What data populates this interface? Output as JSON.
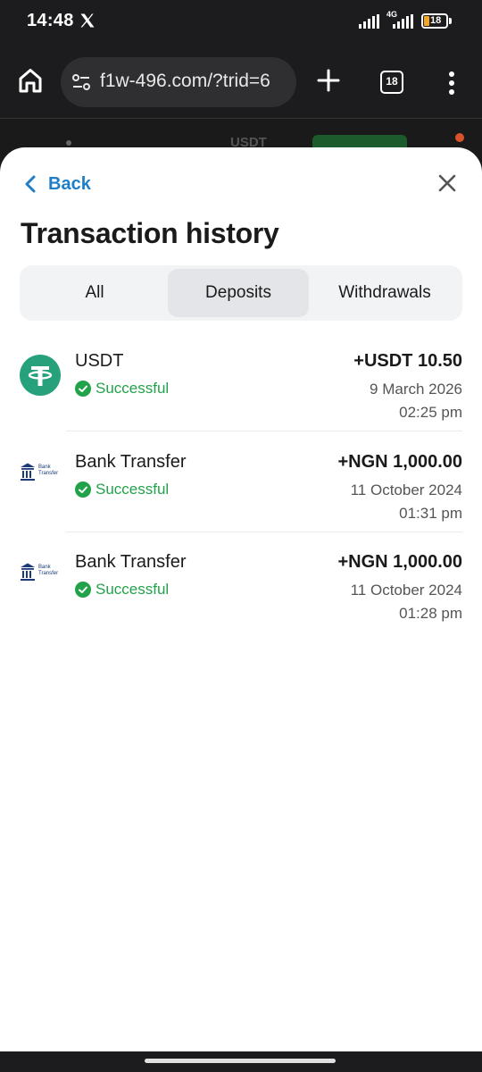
{
  "status_bar": {
    "time": "14:48",
    "network": "4G",
    "battery": "18"
  },
  "browser": {
    "url": "f1w-496.com/?trid=6",
    "tab_count": "18"
  },
  "background_page": {
    "currency": "USDT"
  },
  "sheet": {
    "back_label": "Back",
    "title": "Transaction history",
    "tabs": [
      {
        "label": "All",
        "active": false
      },
      {
        "label": "Deposits",
        "active": true
      },
      {
        "label": "Withdrawals",
        "active": false
      }
    ],
    "transactions": [
      {
        "name": "USDT",
        "status": "Successful",
        "amount": "+USDT 10.50",
        "date": "9 March 2026",
        "time": "02:25 pm",
        "icon": "usdt-icon"
      },
      {
        "name": "Bank Transfer",
        "status": "Successful",
        "amount": "+NGN 1,000.00",
        "date": "11 October 2024",
        "time": "01:31 pm",
        "icon": "bank-transfer-icon",
        "logo_text": [
          "Bank",
          "Transfer"
        ]
      },
      {
        "name": "Bank Transfer",
        "status": "Successful",
        "amount": "+NGN 1,000.00",
        "date": "11 October 2024",
        "time": "01:28 pm",
        "icon": "bank-transfer-icon",
        "logo_text": [
          "Bank",
          "Transfer"
        ]
      }
    ]
  },
  "colors": {
    "accent": "#1e7ec8",
    "success": "#22a24a",
    "usdt": "#26a17b"
  }
}
